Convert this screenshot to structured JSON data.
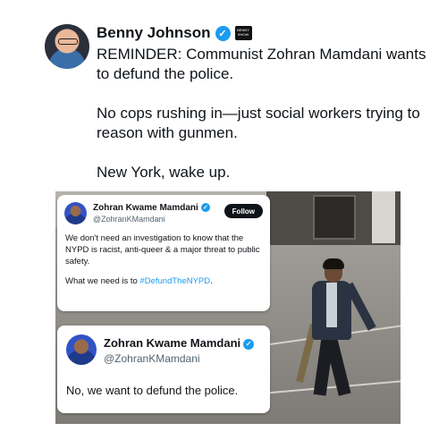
{
  "post": {
    "author": "Benny Johnson",
    "paragraphs": [
      "REMINDER: Communist Zohran Mamdani wants to defund the police.",
      "No cops rushing in—just social workers trying to reason with gunmen.",
      "New York, wake up."
    ],
    "affiliation_badge_text": "Benny Show"
  },
  "embedded_tweets": [
    {
      "name": "Zohran Kwame Mamdani",
      "handle": "@ZohranKMamdani",
      "follow_label": "Follow",
      "text_1": "We don't need an investigation to know that the NYPD is racist, anti-queer & a major threat to public safety.",
      "text_2_prefix": "What we need is to ",
      "hashtag": "#DefundTheNYPD",
      "text_2_suffix": "."
    },
    {
      "name": "Zohran Kwame Mamdani",
      "handle": "@ZohranKMamdani",
      "text": "No, we want to defund the police."
    }
  ],
  "icons": {
    "verified": "verified-check-icon",
    "avatar": "avatar"
  },
  "colors": {
    "verified": "#1d9bf0",
    "hashtag": "#1d9bf0",
    "text": "#0f1419",
    "handle": "#536471"
  }
}
